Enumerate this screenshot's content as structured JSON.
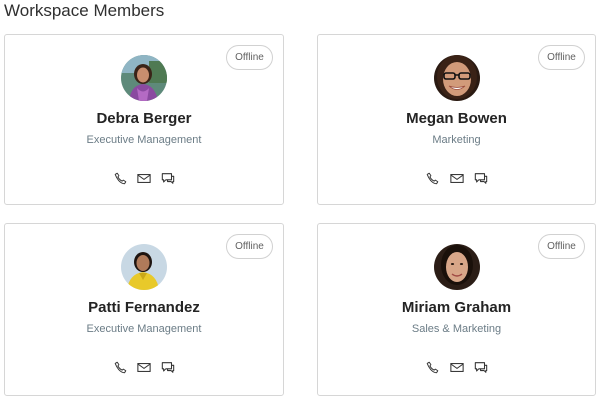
{
  "page": {
    "title": "Workspace Members"
  },
  "members": [
    {
      "name": "Debra Berger",
      "department": "Executive Management",
      "status": "Offline",
      "avatar": "debra-berger-photo"
    },
    {
      "name": "Megan Bowen",
      "department": "Marketing",
      "status": "Offline",
      "avatar": "megan-bowen-photo"
    },
    {
      "name": "Patti Fernandez",
      "department": "Executive Management",
      "status": "Offline",
      "avatar": "patti-fernandez-photo"
    },
    {
      "name": "Miriam Graham",
      "department": "Sales & Marketing",
      "status": "Offline",
      "avatar": "miriam-graham-photo"
    }
  ],
  "actions": {
    "call": "phone-icon",
    "email": "mail-icon",
    "chat": "chat-icon"
  },
  "colors": {
    "border": "#d6d6d6",
    "dept_text": "#6b7c86",
    "name_text": "#242424"
  }
}
